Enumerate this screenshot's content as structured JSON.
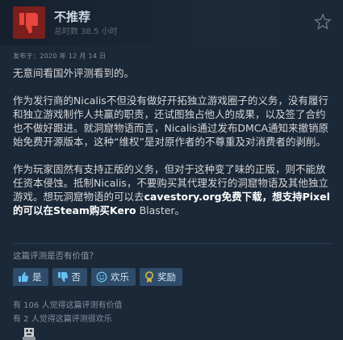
{
  "review": {
    "title": "不推荐",
    "hours": "总时数 38.5 小时",
    "posted": "发布于：2020 年 12 月 14 日"
  },
  "body": {
    "p1": "无意间看国外评测看到的。",
    "p2": "作为发行商的Nicalis不但没有做好开拓独立游戏圈子的义务，没有履行和独立游戏制作人共赢的职责，还试图独占他人的成果，以及签了合约也不做好跟进。就洞窟物语而言，Nicalis通过发布DMCA通知来撤销原始免费开源版本，这种“维权”是对原作者的不尊重及对消费者的剥削。",
    "p3_a": "作为玩家固然有支持正版的义务，但对于这种变了味的正版，则不能放任资本侵蚀。抵制Nicalis，不要购买其代理发行的洞窟物语及其他独立游戏。想玩洞窟物语的可以去",
    "p3_b": "cavestory.org免费下载，想支持Pixel的可以在Steam购买Kero",
    "p3_c": " Blaster。"
  },
  "helpful": {
    "question": "这篇评测是否有价值？",
    "yes": "是",
    "no": "否",
    "funny": "欢乐",
    "award": "奖励",
    "stat_helpful": "有 106 人觉得这篇评测有价值",
    "stat_funny": "有 2 人觉得这篇评测很欢乐"
  },
  "colors": {
    "background": "#1b2838",
    "thumb_box": "#7a1f1b",
    "thumb_icon": "#e8453c",
    "button": "#2f4d6b",
    "award_gold": "#c5a63a"
  },
  "icons": [
    "thumbs-down-icon",
    "star-icon",
    "thumbs-up-icon",
    "smiley-icon",
    "award-ribbon-icon"
  ]
}
